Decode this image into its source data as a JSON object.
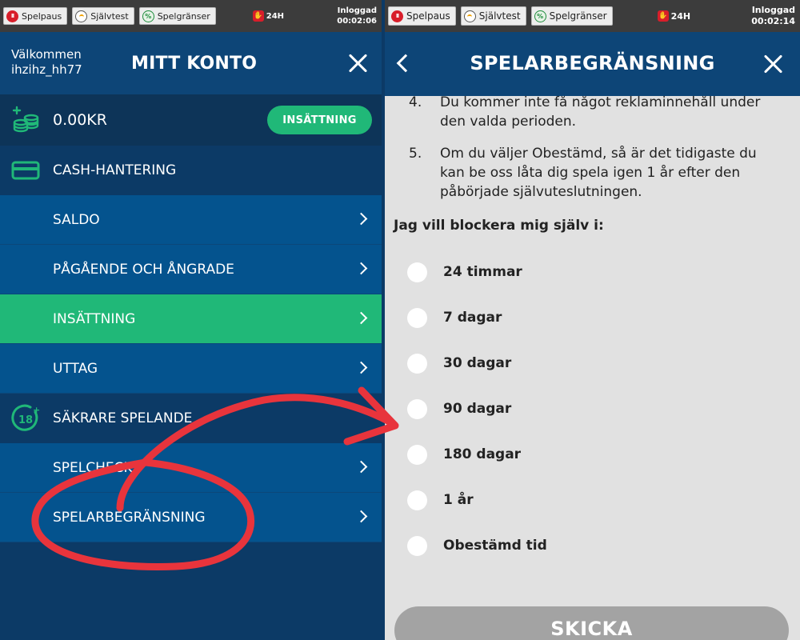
{
  "left_topbar": {
    "spelpaus": "Spelpaus",
    "sjalvtest": "Självtest",
    "spelgranser": "Spelgränser",
    "limit_24h": "24H",
    "logged_in_label": "Inloggad",
    "session_time": "00:02:06"
  },
  "right_topbar": {
    "spelpaus": "Spelpaus",
    "sjalvtest": "Självtest",
    "spelgranser": "Spelgränser",
    "limit_24h": "24H",
    "logged_in_label": "Inloggad",
    "session_time": "00:02:14"
  },
  "account": {
    "welcome": "Välkommen",
    "username": "ihzihz_hh77",
    "title": "MITT KONTO",
    "balance": "0.00KR",
    "deposit_button": "INSÄTTNING",
    "cash_section": "CASH-HANTERING",
    "cash_items": [
      "SALDO",
      "PÅGÅENDE OCH ÅNGRADE",
      "INSÄTTNING",
      "UTTAG"
    ],
    "safer_section": "SÄKRARE SPELANDE",
    "safer_items": [
      "SPELCHECK",
      "SPELARBEGRÄNSNING"
    ]
  },
  "limits": {
    "title": "SPELARBEGRÄNSNING",
    "rules": [
      {
        "num": "4.",
        "text": "Du kommer inte få något reklaminnehåll under den valda perioden."
      },
      {
        "num": "5.",
        "text": "Om du väljer Obestämd, så är det tidigaste du kan be oss låta dig spela igen 1 år efter den påbörjade självuteslutningen."
      }
    ],
    "block_label": "Jag vill blockera mig själv i:",
    "options": [
      "24 timmar",
      "7 dagar",
      "30 dagar",
      "90 dagar",
      "180 dagar",
      "1 år",
      "Obestämd tid"
    ],
    "submit": "SKICKA"
  },
  "colors": {
    "navy": "#0c3a66",
    "menu_blue": "#04538e",
    "accent_green": "#20b878",
    "annotation_red": "#e8343c"
  }
}
